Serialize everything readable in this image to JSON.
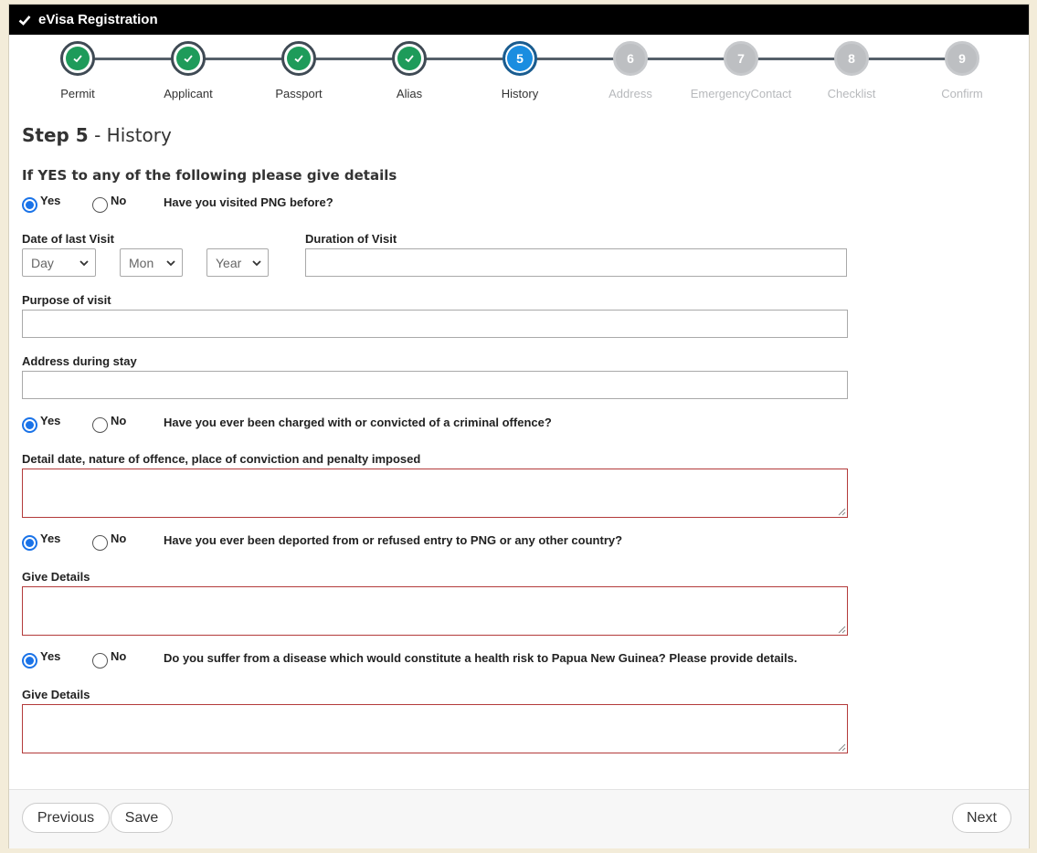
{
  "window": {
    "title": "eVisa Registration"
  },
  "stepper": [
    {
      "number": "1",
      "label": "Permit",
      "state": "done"
    },
    {
      "number": "2",
      "label": "Applicant",
      "state": "done"
    },
    {
      "number": "3",
      "label": "Passport",
      "state": "done"
    },
    {
      "number": "4",
      "label": "Alias",
      "state": "done"
    },
    {
      "number": "5",
      "label": "History",
      "state": "active"
    },
    {
      "number": "6",
      "label": "Address",
      "state": "todo"
    },
    {
      "number": "7",
      "label": "EmergencyContact",
      "state": "todo"
    },
    {
      "number": "8",
      "label": "Checklist",
      "state": "todo"
    },
    {
      "number": "9",
      "label": "Confirm",
      "state": "todo"
    }
  ],
  "heading": {
    "step": "Step 5",
    "separator": " - ",
    "name": "History"
  },
  "subheading": "If YES to any of the following please give details",
  "yes_label": "Yes",
  "no_label": "No",
  "questions": {
    "visited": "Have you visited PNG before?",
    "criminal": "Have you ever been charged with or convicted of a criminal offence?",
    "deported": "Have you ever been deported from or refused entry to PNG or any other country?",
    "health": "Do you suffer from a disease which would constitute a health risk to Papua New Guinea? Please provide details."
  },
  "answers": {
    "visited": "Yes",
    "criminal": "Yes",
    "deported": "Yes",
    "health": "Yes"
  },
  "fields": {
    "last_visit_label": "Date of last Visit",
    "day": "Day",
    "month": "Mon",
    "year": "Year",
    "duration_label": "Duration of Visit",
    "duration_value": "",
    "purpose_label": "Purpose of visit",
    "purpose_value": "",
    "address_label": "Address during stay",
    "address_value": "",
    "criminal_detail_label": "Detail date, nature of offence, place of conviction and penalty imposed",
    "deported_detail_label": "Give Details",
    "health_detail_label": "Give Details"
  },
  "buttons": {
    "previous": "Previous",
    "save": "Save",
    "next": "Next"
  },
  "colors": {
    "active_step": "#1a8de0",
    "done_step": "#1e9b5a",
    "textarea_border": "#b33a3a"
  }
}
